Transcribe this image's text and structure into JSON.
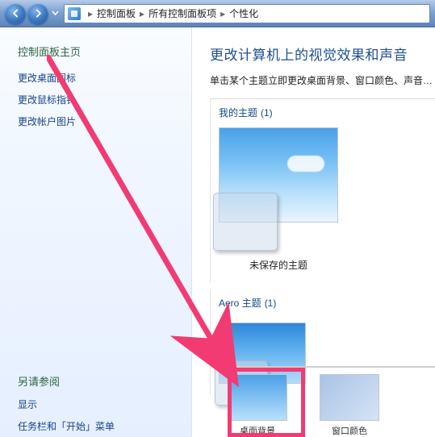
{
  "nav": {
    "dropdown_icon": "▾"
  },
  "breadcrumb": {
    "items": [
      "控制面板",
      "所有控制面板项",
      "个性化"
    ]
  },
  "sidebar": {
    "title": "控制面板主页",
    "links": [
      "更改桌面图标",
      "更改鼠标指针",
      "更改帐户图片"
    ],
    "see_title": "另请参阅",
    "see_links": [
      "显示",
      "任务栏和「开始」菜单"
    ]
  },
  "main": {
    "heading": "更改计算机上的视觉效果和声音",
    "subtext": "单击某个主题立即更改桌面背景、窗口颜色、声音…"
  },
  "groups": {
    "my": {
      "label": "我的主题",
      "count": "(1)",
      "item_label": "未保存的主题"
    },
    "aero": {
      "label": "Aero 主题",
      "count": "(1)"
    }
  },
  "strip": {
    "item1": "桌面背景",
    "item2": "窗口颜色"
  }
}
